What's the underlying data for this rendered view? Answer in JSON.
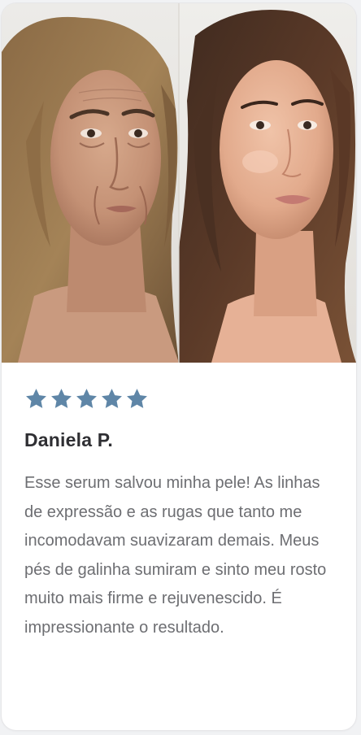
{
  "review_card": {
    "rating": 5,
    "rating_max": 5,
    "star_color": "#5f86a7",
    "reviewer_name": "Daniela P.",
    "review_text": "Esse serum salvou minha pele! As linhas de expressão e as rugas que tanto me incomodavam suavizaram demais. Meus pés de galinha sumiram e sinto meu rosto muito mais firme e rejuvenescido. É impressionante o resultado.",
    "image": {
      "content": "before-after-face-comparison",
      "left": "before",
      "right": "after"
    }
  }
}
